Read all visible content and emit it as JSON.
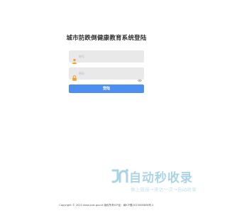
{
  "page": {
    "title": "城市防跌倒健康教育系统登陆"
  },
  "form": {
    "username_placeholder": "账号",
    "password_placeholder": "密码",
    "login_label": "登陆",
    "username_icon": "user-icon",
    "password_icon": "lock-icon",
    "toggle_icon": "eye-icon"
  },
  "watermark": {
    "title": "自动秒收录",
    "subtitle": "做上链接→来访一次→自动收录"
  },
  "footer": {
    "text": "Copyright © 2020 www.jcdc.gov.tt 版权所有ICP证：闽ICP备2023006806号-1"
  },
  "colors": {
    "accent": "#4d8ff0",
    "field_bg": "#e9e9e9",
    "watermark": "#9ccde0"
  }
}
